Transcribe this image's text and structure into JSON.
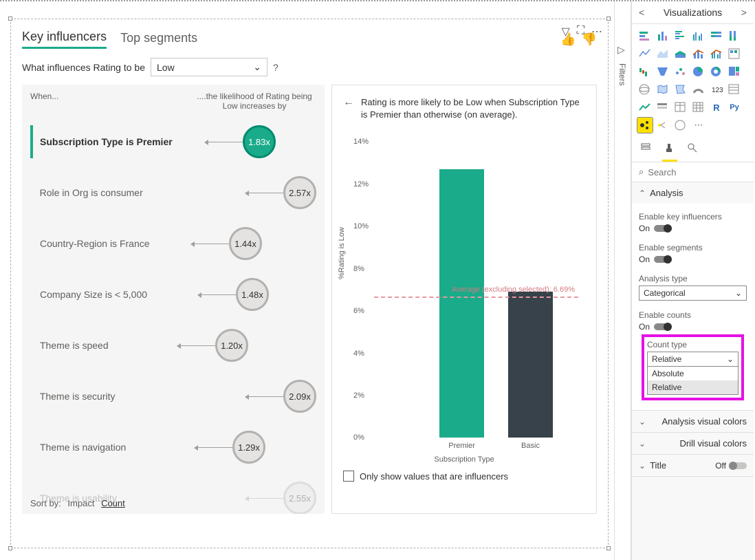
{
  "tabs": {
    "key_influencers": "Key influencers",
    "top_segments": "Top segments"
  },
  "question": {
    "prefix": "What influences Rating to be",
    "value": "Low",
    "help": "?"
  },
  "left": {
    "head_when": "When...",
    "head_likely": "....the likelihood of Rating being Low increases by",
    "items": [
      {
        "label": "Subscription Type is Premier",
        "value": "1.83x",
        "selected": true
      },
      {
        "label": "Role in Org is consumer",
        "value": "2.57x"
      },
      {
        "label": "Country-Region is France",
        "value": "1.44x"
      },
      {
        "label": "Company Size is < 5,000",
        "value": "1.48x"
      },
      {
        "label": "Theme is speed",
        "value": "1.20x"
      },
      {
        "label": "Theme is security",
        "value": "2.09x"
      },
      {
        "label": "Theme is navigation",
        "value": "1.29x"
      },
      {
        "label": "Theme is usability",
        "value": "2.55x"
      }
    ],
    "sort_label": "Sort by:",
    "sort_impact": "Impact",
    "sort_count": "Count"
  },
  "right": {
    "headline": "Rating is more likely to be Low when Subscription Type is Premier than otherwise (on average).",
    "checkbox": "Only show values that are influencers"
  },
  "chart_data": {
    "type": "bar",
    "categories": [
      "Premier",
      "Basic"
    ],
    "values": [
      12.7,
      6.9
    ],
    "ylabel": "%Rating is Low",
    "xlabel": "Subscription Type",
    "ylim": [
      0,
      14
    ],
    "yticks": [
      0,
      2,
      4,
      6,
      8,
      10,
      12,
      14
    ],
    "avg_line": {
      "value": 6.69,
      "label": "Average (excluding selected): 6.69%"
    }
  },
  "pane": {
    "title": "Visualizations",
    "filters": "Filters",
    "search_ph": "Search",
    "analysis_hd": "Analysis",
    "enable_ki": "Enable key influencers",
    "enable_seg": "Enable segments",
    "analysis_type_lbl": "Analysis type",
    "analysis_type_val": "Categorical",
    "enable_counts": "Enable counts",
    "count_type_lbl": "Count type",
    "count_type_val": "Relative",
    "count_type_opts": [
      "Absolute",
      "Relative"
    ],
    "on": "On",
    "off": "Off",
    "sec_av_colors": "Analysis visual colors",
    "sec_dv_colors": "Drill visual colors",
    "sec_title": "Title"
  }
}
